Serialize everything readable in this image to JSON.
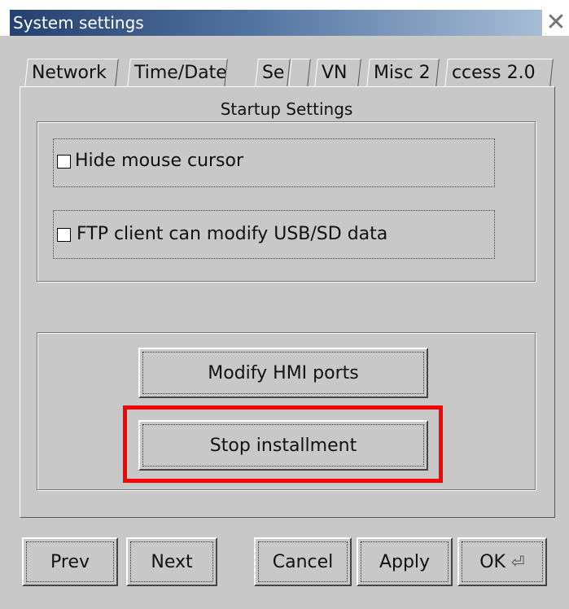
{
  "window": {
    "title": "System settings",
    "close_icon": "close-icon"
  },
  "tabs": [
    {
      "label": "Network"
    },
    {
      "label": "Time/Date"
    },
    {
      "label": "Se"
    },
    {
      "label": ""
    },
    {
      "label": "VN"
    },
    {
      "label": "Misc 2",
      "active": true
    },
    {
      "label": "ccess 2.0"
    }
  ],
  "startup": {
    "title": "Startup Settings",
    "hide_cursor_label": "Hide mouse cursor",
    "hide_cursor_checked": false,
    "ftp_label": "FTP client can modify USB/SD data",
    "ftp_checked": false
  },
  "actions": {
    "modify_ports": "Modify HMI ports",
    "stop_install": "Stop installment"
  },
  "footer": {
    "prev": "Prev",
    "next": "Next",
    "cancel": "Cancel",
    "apply": "Apply",
    "ok": "OK",
    "ok_icon": "enter-icon"
  },
  "colors": {
    "highlight": "#ff0000",
    "titlebar_start": "#25406f",
    "titlebar_end": "#a7bdd6"
  }
}
